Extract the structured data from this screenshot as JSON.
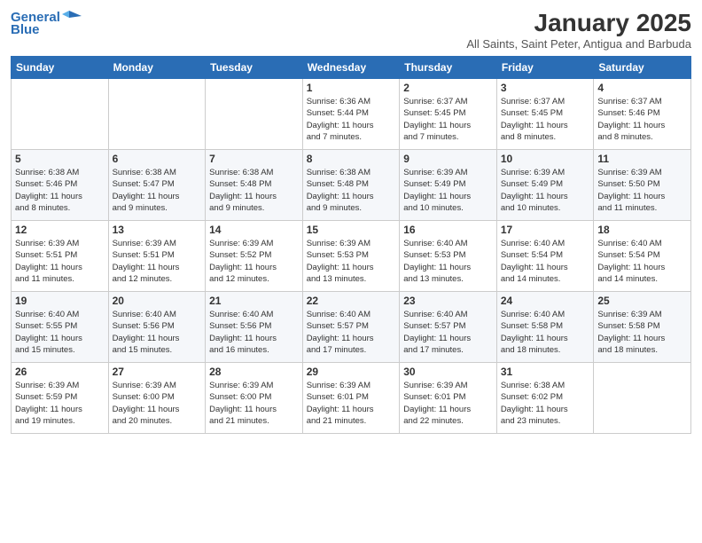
{
  "header": {
    "logo_line1": "General",
    "logo_line2": "Blue",
    "month": "January 2025",
    "location": "All Saints, Saint Peter, Antigua and Barbuda"
  },
  "days_of_week": [
    "Sunday",
    "Monday",
    "Tuesday",
    "Wednesday",
    "Thursday",
    "Friday",
    "Saturday"
  ],
  "weeks": [
    [
      {
        "day": "",
        "info": ""
      },
      {
        "day": "",
        "info": ""
      },
      {
        "day": "",
        "info": ""
      },
      {
        "day": "1",
        "info": "Sunrise: 6:36 AM\nSunset: 5:44 PM\nDaylight: 11 hours\nand 7 minutes."
      },
      {
        "day": "2",
        "info": "Sunrise: 6:37 AM\nSunset: 5:45 PM\nDaylight: 11 hours\nand 7 minutes."
      },
      {
        "day": "3",
        "info": "Sunrise: 6:37 AM\nSunset: 5:45 PM\nDaylight: 11 hours\nand 8 minutes."
      },
      {
        "day": "4",
        "info": "Sunrise: 6:37 AM\nSunset: 5:46 PM\nDaylight: 11 hours\nand 8 minutes."
      }
    ],
    [
      {
        "day": "5",
        "info": "Sunrise: 6:38 AM\nSunset: 5:46 PM\nDaylight: 11 hours\nand 8 minutes."
      },
      {
        "day": "6",
        "info": "Sunrise: 6:38 AM\nSunset: 5:47 PM\nDaylight: 11 hours\nand 9 minutes."
      },
      {
        "day": "7",
        "info": "Sunrise: 6:38 AM\nSunset: 5:48 PM\nDaylight: 11 hours\nand 9 minutes."
      },
      {
        "day": "8",
        "info": "Sunrise: 6:38 AM\nSunset: 5:48 PM\nDaylight: 11 hours\nand 9 minutes."
      },
      {
        "day": "9",
        "info": "Sunrise: 6:39 AM\nSunset: 5:49 PM\nDaylight: 11 hours\nand 10 minutes."
      },
      {
        "day": "10",
        "info": "Sunrise: 6:39 AM\nSunset: 5:49 PM\nDaylight: 11 hours\nand 10 minutes."
      },
      {
        "day": "11",
        "info": "Sunrise: 6:39 AM\nSunset: 5:50 PM\nDaylight: 11 hours\nand 11 minutes."
      }
    ],
    [
      {
        "day": "12",
        "info": "Sunrise: 6:39 AM\nSunset: 5:51 PM\nDaylight: 11 hours\nand 11 minutes."
      },
      {
        "day": "13",
        "info": "Sunrise: 6:39 AM\nSunset: 5:51 PM\nDaylight: 11 hours\nand 12 minutes."
      },
      {
        "day": "14",
        "info": "Sunrise: 6:39 AM\nSunset: 5:52 PM\nDaylight: 11 hours\nand 12 minutes."
      },
      {
        "day": "15",
        "info": "Sunrise: 6:39 AM\nSunset: 5:53 PM\nDaylight: 11 hours\nand 13 minutes."
      },
      {
        "day": "16",
        "info": "Sunrise: 6:40 AM\nSunset: 5:53 PM\nDaylight: 11 hours\nand 13 minutes."
      },
      {
        "day": "17",
        "info": "Sunrise: 6:40 AM\nSunset: 5:54 PM\nDaylight: 11 hours\nand 14 minutes."
      },
      {
        "day": "18",
        "info": "Sunrise: 6:40 AM\nSunset: 5:54 PM\nDaylight: 11 hours\nand 14 minutes."
      }
    ],
    [
      {
        "day": "19",
        "info": "Sunrise: 6:40 AM\nSunset: 5:55 PM\nDaylight: 11 hours\nand 15 minutes."
      },
      {
        "day": "20",
        "info": "Sunrise: 6:40 AM\nSunset: 5:56 PM\nDaylight: 11 hours\nand 15 minutes."
      },
      {
        "day": "21",
        "info": "Sunrise: 6:40 AM\nSunset: 5:56 PM\nDaylight: 11 hours\nand 16 minutes."
      },
      {
        "day": "22",
        "info": "Sunrise: 6:40 AM\nSunset: 5:57 PM\nDaylight: 11 hours\nand 17 minutes."
      },
      {
        "day": "23",
        "info": "Sunrise: 6:40 AM\nSunset: 5:57 PM\nDaylight: 11 hours\nand 17 minutes."
      },
      {
        "day": "24",
        "info": "Sunrise: 6:40 AM\nSunset: 5:58 PM\nDaylight: 11 hours\nand 18 minutes."
      },
      {
        "day": "25",
        "info": "Sunrise: 6:39 AM\nSunset: 5:58 PM\nDaylight: 11 hours\nand 18 minutes."
      }
    ],
    [
      {
        "day": "26",
        "info": "Sunrise: 6:39 AM\nSunset: 5:59 PM\nDaylight: 11 hours\nand 19 minutes."
      },
      {
        "day": "27",
        "info": "Sunrise: 6:39 AM\nSunset: 6:00 PM\nDaylight: 11 hours\nand 20 minutes."
      },
      {
        "day": "28",
        "info": "Sunrise: 6:39 AM\nSunset: 6:00 PM\nDaylight: 11 hours\nand 21 minutes."
      },
      {
        "day": "29",
        "info": "Sunrise: 6:39 AM\nSunset: 6:01 PM\nDaylight: 11 hours\nand 21 minutes."
      },
      {
        "day": "30",
        "info": "Sunrise: 6:39 AM\nSunset: 6:01 PM\nDaylight: 11 hours\nand 22 minutes."
      },
      {
        "day": "31",
        "info": "Sunrise: 6:38 AM\nSunset: 6:02 PM\nDaylight: 11 hours\nand 23 minutes."
      },
      {
        "day": "",
        "info": ""
      }
    ]
  ]
}
